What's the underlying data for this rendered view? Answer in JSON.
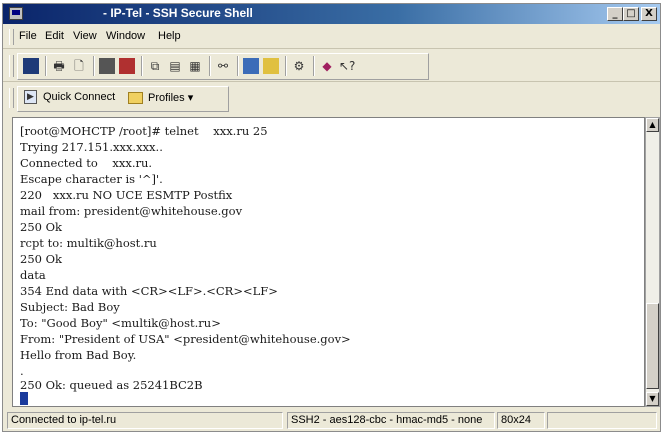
{
  "window": {
    "title": "- IP-Tel - SSH Secure Shell"
  },
  "titlebar_buttons": {
    "minimize": "_",
    "maximize": "□",
    "close": "X"
  },
  "menu": [
    "File",
    "Edit",
    "View",
    "Window",
    "Help"
  ],
  "toolbar_icons": [
    "save-icon",
    "print-icon",
    "print-preview-icon",
    "disconnect-icon",
    "new-connection-icon",
    "copy-icon",
    "paste-icon",
    "paste-clipboard-icon",
    "find-icon",
    "file-transfer-icon",
    "folder-icon",
    "settings-icon",
    "help-book-icon",
    "help-pointer-icon"
  ],
  "quickbar": {
    "quick_connect": "Quick Connect",
    "profiles": "Profiles ▾"
  },
  "terminal_lines": [
    "[root@MOHCTP /root]# telnet    xxx.ru 25",
    "Trying 217.151.xxx.xxx..",
    "Connected to    xxx.ru.",
    "Escape character is '^]'.",
    "220   xxx.ru NO UCE ESMTP Postfix",
    "mail from: president@whitehouse.gov",
    "250 Ok",
    "rcpt to: multik@host.ru",
    "250 Ok",
    "data",
    "354 End data with <CR><LF>.<CR><LF>",
    "Subject: Bad Boy",
    "To: \"Good Boy\" <multik@host.ru>",
    "From: \"President of USA\" <president@whitehouse.gov>",
    "Hello from Bad Boy.",
    ".",
    "250 Ok: queued as 25241BC2B"
  ],
  "status": {
    "connection": "Connected to ip-tel.ru",
    "cipher": "SSH2 - aes128-cbc - hmac-md5 - none",
    "size": "80x24"
  },
  "scrollbar": {
    "up": "▲",
    "down": "▼"
  }
}
